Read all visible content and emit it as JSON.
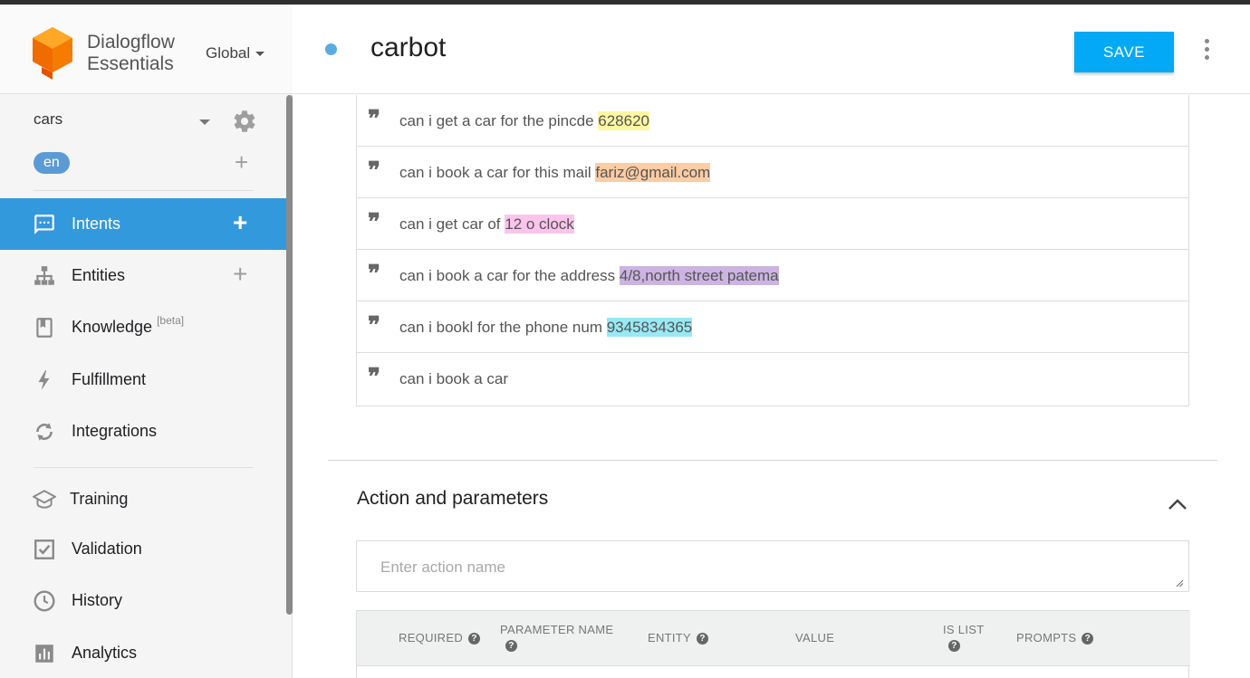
{
  "brand": {
    "line1": "Dialogflow",
    "line2": "Essentials",
    "region": "Global"
  },
  "agent": {
    "name": "cars",
    "language": "en"
  },
  "nav": {
    "items": [
      {
        "label": "Intents",
        "icon": "intents-icon",
        "active": true,
        "has_add": true
      },
      {
        "label": "Entities",
        "icon": "entities-icon",
        "has_add": true
      },
      {
        "label": "Knowledge",
        "icon": "knowledge-icon",
        "badge": "[beta]"
      },
      {
        "label": "Fulfillment",
        "icon": "fulfillment-icon"
      },
      {
        "label": "Integrations",
        "icon": "integrations-icon"
      },
      {
        "label": "Training",
        "icon": "training-icon"
      },
      {
        "label": "Validation",
        "icon": "validation-icon"
      },
      {
        "label": "History",
        "icon": "history-icon"
      },
      {
        "label": "Analytics",
        "icon": "analytics-icon"
      }
    ]
  },
  "header": {
    "title": "carbot",
    "save_label": "SAVE"
  },
  "training_phrases": [
    {
      "text": "can i get a car for the pincde ",
      "entity": "628620",
      "color": "#fdf7a1"
    },
    {
      "text": "can i book a car for this mail ",
      "entity": "fariz@gmail.com",
      "color": "#fccca3"
    },
    {
      "text": "can i get car of ",
      "entity": "12 o clock",
      "color": "#fbc4ec"
    },
    {
      "text": "can i book a car for the address ",
      "entity": "4/8,north street patema",
      "color": "#cbb4e1"
    },
    {
      "text": "can i bookl for the phone num ",
      "entity": "9345834365",
      "color": "#98e9f3"
    },
    {
      "text": "can i book a car",
      "entity": "",
      "color": ""
    }
  ],
  "actions": {
    "title": "Action and parameters",
    "placeholder": "Enter action name",
    "columns": {
      "required": "REQUIRED",
      "parameter_name": "PARAMETER NAME",
      "entity": "ENTITY",
      "value": "VALUE",
      "is_list": "IS LIST",
      "prompts": "PROMPTS"
    }
  },
  "colors": {
    "accent": "#03a9f4",
    "nav_active": "#3399dd",
    "status_dot": "#5aabe0"
  }
}
